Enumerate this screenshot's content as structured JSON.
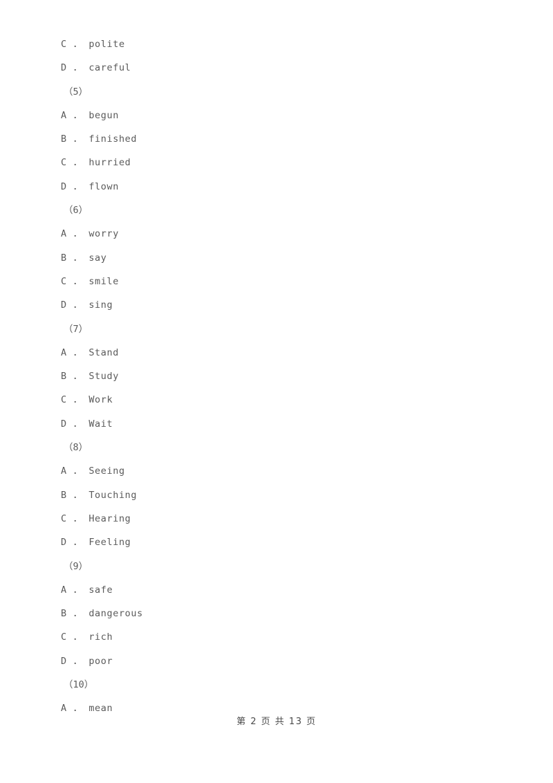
{
  "document": {
    "page_background": "#ffffff",
    "text_color": "#5a5a5a",
    "footer_text_color": "#4a4a4a"
  },
  "body_lines": [
    {
      "kind": "option",
      "letter": "C",
      "separator": "．",
      "text": "polite"
    },
    {
      "kind": "option",
      "letter": "D",
      "separator": "．",
      "text": "careful"
    },
    {
      "kind": "question",
      "label": "（5）"
    },
    {
      "kind": "option",
      "letter": "A",
      "separator": "．",
      "text": "begun"
    },
    {
      "kind": "option",
      "letter": "B",
      "separator": "．",
      "text": "finished"
    },
    {
      "kind": "option",
      "letter": "C",
      "separator": "．",
      "text": "hurried"
    },
    {
      "kind": "option",
      "letter": "D",
      "separator": "．",
      "text": "flown"
    },
    {
      "kind": "question",
      "label": "（6）"
    },
    {
      "kind": "option",
      "letter": "A",
      "separator": "．",
      "text": "worry"
    },
    {
      "kind": "option",
      "letter": "B",
      "separator": "．",
      "text": "say"
    },
    {
      "kind": "option",
      "letter": "C",
      "separator": "．",
      "text": "smile"
    },
    {
      "kind": "option",
      "letter": "D",
      "separator": "．",
      "text": "sing"
    },
    {
      "kind": "question",
      "label": "（7）"
    },
    {
      "kind": "option",
      "letter": "A",
      "separator": "．",
      "text": "Stand"
    },
    {
      "kind": "option",
      "letter": "B",
      "separator": "．",
      "text": "Study"
    },
    {
      "kind": "option",
      "letter": "C",
      "separator": "．",
      "text": "Work"
    },
    {
      "kind": "option",
      "letter": "D",
      "separator": "．",
      "text": "Wait"
    },
    {
      "kind": "question",
      "label": "（8）"
    },
    {
      "kind": "option",
      "letter": "A",
      "separator": "．",
      "text": "Seeing"
    },
    {
      "kind": "option",
      "letter": "B",
      "separator": "．",
      "text": "Touching"
    },
    {
      "kind": "option",
      "letter": "C",
      "separator": "．",
      "text": "Hearing"
    },
    {
      "kind": "option",
      "letter": "D",
      "separator": "．",
      "text": "Feeling"
    },
    {
      "kind": "question",
      "label": "（9）"
    },
    {
      "kind": "option",
      "letter": "A",
      "separator": "．",
      "text": "safe"
    },
    {
      "kind": "option",
      "letter": "B",
      "separator": "．",
      "text": "dangerous"
    },
    {
      "kind": "option",
      "letter": "C",
      "separator": "．",
      "text": "rich"
    },
    {
      "kind": "option",
      "letter": "D",
      "separator": "．",
      "text": "poor"
    },
    {
      "kind": "question",
      "label": "（10）"
    },
    {
      "kind": "option",
      "letter": "A",
      "separator": "．",
      "text": "mean"
    }
  ],
  "footer": {
    "text": "第 2 页 共 13 页",
    "current_page": "2",
    "total_pages": "13"
  }
}
